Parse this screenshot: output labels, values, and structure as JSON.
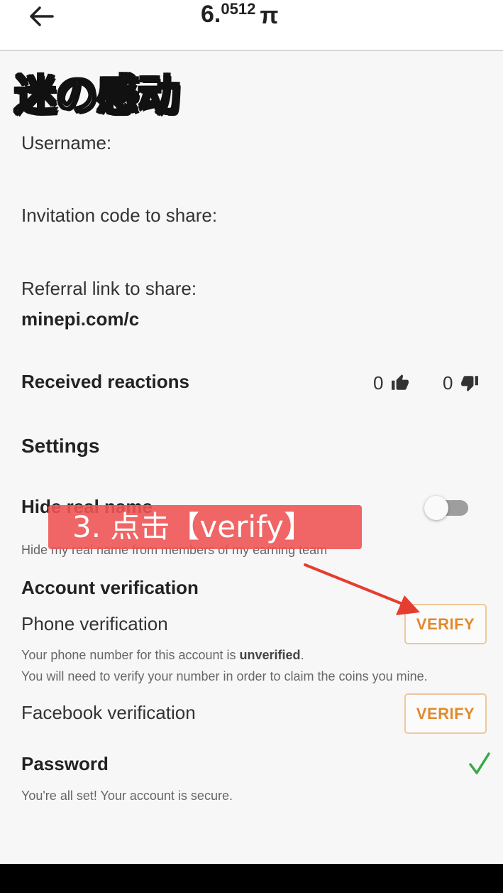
{
  "header": {
    "balance_int": "6.",
    "balance_dec": "0512",
    "currency_symbol": "π"
  },
  "overlay_title": "迷の感动",
  "profile": {
    "username_label": "Username:",
    "invitation_label": "Invitation code to share:",
    "referral_label": "Referral link to share:",
    "referral_value": "minepi.com/c",
    "reactions_label": "Received reactions",
    "thumbs_up_count": "0",
    "thumbs_down_count": "0"
  },
  "settings": {
    "title": "Settings",
    "hide_real_name_label": "Hide real name",
    "hide_real_name_desc": "Hide my real name from members of my earning team",
    "hide_real_name_on": false
  },
  "instruction_banner": "3. 点击【verify】",
  "verification": {
    "title": "Account verification",
    "phone_label": "Phone verification",
    "phone_button": "VERIFY",
    "phone_note_prefix": "Your phone number for this account is ",
    "phone_note_status": "unverified",
    "phone_note_suffix": ".",
    "phone_note_line2": "You will need to verify your number in order to claim the coins you mine.",
    "facebook_label": "Facebook verification",
    "facebook_button": "VERIFY",
    "password_label": "Password",
    "password_note": "You're all set! Your account is secure."
  },
  "colors": {
    "accent_orange": "#e08a2e",
    "instruction_red": "#ee5454",
    "check_green": "#3aa84a"
  }
}
